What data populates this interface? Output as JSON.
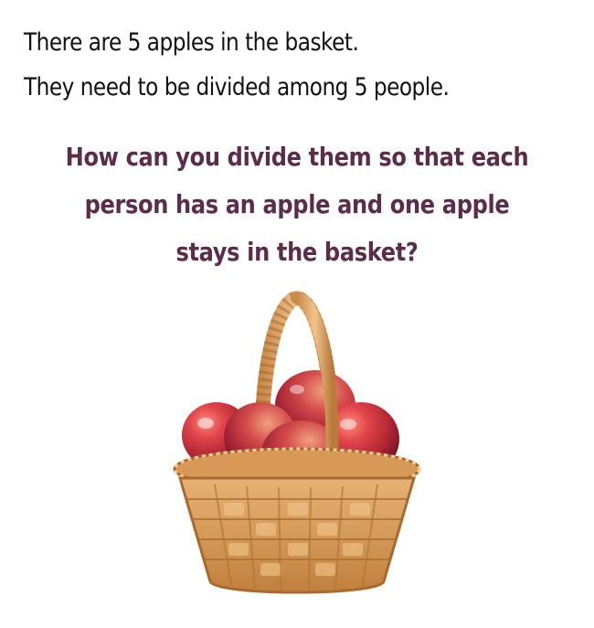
{
  "intro": {
    "line1": "There are 5 apples in the basket.",
    "line2": "They need to be divided among 5 people."
  },
  "question": {
    "line1": "How can you divide them so that each",
    "line2": "person has an apple and one apple",
    "line3": "stays in the basket?"
  },
  "colors": {
    "background": "#ffffff",
    "intro_text": "#111111",
    "question_text": "#5a2d4a",
    "apple_red": "#c8323a",
    "basket_tan": "#d9a063"
  },
  "illustration": {
    "subject": "basket-of-apples",
    "apple_count": 5
  }
}
